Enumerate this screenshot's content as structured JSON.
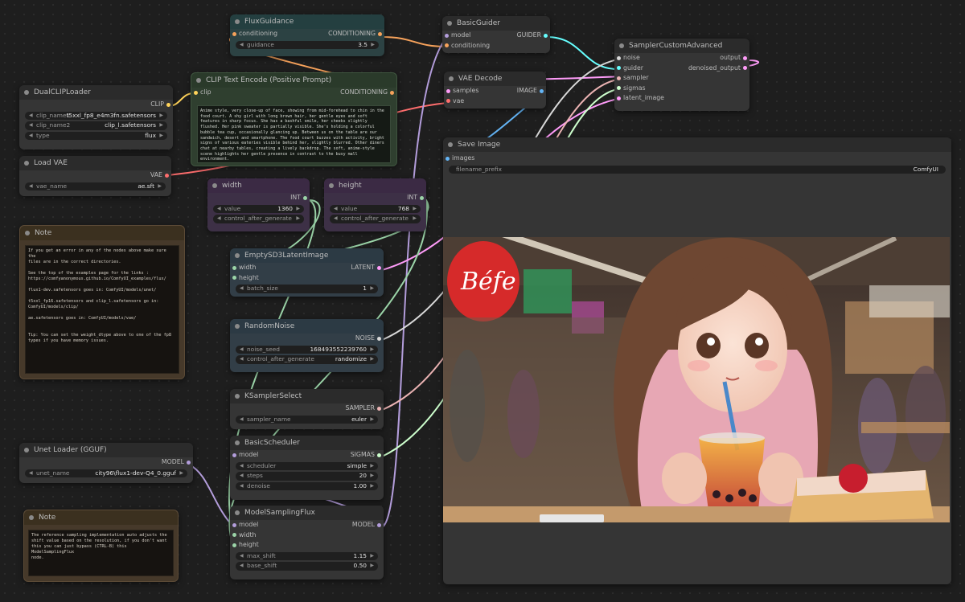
{
  "colors": {
    "clip": "#ffd35a",
    "conditioning": "#f6a25b",
    "vae": "#ff6e6e",
    "model": "#b39ddb",
    "latent": "#ff9cf9",
    "int": "#9bd4a8",
    "noise": "#d9d9d9",
    "sampler": "#ecb4b4",
    "sigmas": "#cdffcd",
    "guider": "#66ffff",
    "image": "#64b5f6"
  },
  "nodes": {
    "flux_guidance": {
      "title": "FluxGuidance",
      "in_conditioning": "conditioning",
      "out_conditioning": "CONDITIONING",
      "guidance_label": "guidance",
      "guidance_value": "3.5"
    },
    "basic_guider": {
      "title": "BasicGuider",
      "in_model": "model",
      "in_conditioning": "conditioning",
      "out_guider": "GUIDER"
    },
    "sampler_custom": {
      "title": "SamplerCustomAdvanced",
      "in_noise": "noise",
      "in_guider": "guider",
      "in_sampler": "sampler",
      "in_sigmas": "sigmas",
      "in_latent": "latent_image",
      "out_output": "output",
      "out_denoised": "denoised_output"
    },
    "vae_decode": {
      "title": "VAE Decode",
      "in_samples": "samples",
      "in_vae": "vae",
      "out_image": "IMAGE"
    },
    "dual_clip": {
      "title": "DualCLIPLoader",
      "out_clip": "CLIP",
      "clip_name1_label": "clip_name1",
      "clip_name1_value": "t5xxl_fp8_e4m3fn.safetensors",
      "clip_name2_label": "clip_name2",
      "clip_name2_value": "clip_l.safetensors",
      "type_label": "type",
      "type_value": "flux"
    },
    "clip_text": {
      "title": "CLIP Text Encode (Positive Prompt)",
      "in_clip": "clip",
      "out_conditioning": "CONDITIONING",
      "prompt": "Anime style, very close-up of face, showing from mid-forehead to chin in the food court. A shy girl with long brown hair, her gentle eyes and soft features in sharp focus. She has a bashful smile, her cheeks slightly flushed. Her pink sweater is partially visible. She's holding a colorful bubble tea cup, occasionally glancing up. Between us on the table are our sandwich, desert and smartphone. The food court buzzes with activity, bright signs of various eateries visible behind her, slightly blurred. Other diners chat at nearby tables, creating a lively backdrop. The soft, anime-style scene highlights her gentle presence in contrast to the busy mall environment."
    },
    "load_vae": {
      "title": "Load VAE",
      "out_vae": "VAE",
      "vae_name_label": "vae_name",
      "vae_name_value": "ae.sft"
    },
    "width": {
      "title": "width",
      "out_int": "INT",
      "value_label": "value",
      "value": "1360",
      "control_label": "control_after_generate",
      "control_value": "fixed"
    },
    "height": {
      "title": "height",
      "out_int": "INT",
      "value_label": "value",
      "value": "768",
      "control_label": "control_after_generate",
      "control_value": "fixed"
    },
    "save_image": {
      "title": "Save Image",
      "in_images": "images",
      "prefix_label": "filename_prefix",
      "prefix_value": "ComfyUI"
    },
    "note1": {
      "title": "Note",
      "text": "If you get an error in any of the nodes above make sure the\nfiles are in the correct directories.\n\nSee the top of the examples page for the links :\nhttps://comfyanonymous.github.io/ComfyUI_examples/flux/\n\nflux1-dev.safetensors goes in: ComfyUI/models/unet/\n\nt5xxl_fp16.safetensors and clip_l.safetensors go in:\nComfyUI/models/clip/\n\nae.safetensors goes in: ComfyUI/models/vae/\n\n\nTip: You can set the weight_dtype above to one of the fp8\ntypes if you have memory issues."
    },
    "empty_latent": {
      "title": "EmptySD3LatentImage",
      "in_width": "width",
      "in_height": "height",
      "out_latent": "LATENT",
      "batch_label": "batch_size",
      "batch_value": "1"
    },
    "random_noise": {
      "title": "RandomNoise",
      "out_noise": "NOISE",
      "seed_label": "noise_seed",
      "seed_value": "168493552239760",
      "control_label": "control_after_generate",
      "control_value": "randomize"
    },
    "ksampler_select": {
      "title": "KSamplerSelect",
      "out_sampler": "SAMPLER",
      "sampler_label": "sampler_name",
      "sampler_value": "euler"
    },
    "unet_loader": {
      "title": "Unet Loader (GGUF)",
      "out_model": "MODEL",
      "unet_label": "unet_name",
      "unet_value": "city96\\flux1-dev-Q4_0.gguf"
    },
    "basic_scheduler": {
      "title": "BasicScheduler",
      "in_model": "model",
      "out_sigmas": "SIGMAS",
      "scheduler_label": "scheduler",
      "scheduler_value": "simple",
      "steps_label": "steps",
      "steps_value": "20",
      "denoise_label": "denoise",
      "denoise_value": "1.00"
    },
    "note2": {
      "title": "Note",
      "text": "The reference sampling implementation auto adjusts the\nshift value based on the resolution, if you don't want\nthis you can just bypass (CTRL-B) this ModelSamplingFlux\nnode."
    },
    "model_sampling": {
      "title": "ModelSamplingFlux",
      "in_model": "model",
      "in_width": "width",
      "in_height": "height",
      "out_model": "MODEL",
      "max_label": "max_shift",
      "max_value": "1.15",
      "base_label": "base_shift",
      "base_value": "0.50"
    }
  },
  "preview_image": {
    "sign_text": "Béfe"
  }
}
